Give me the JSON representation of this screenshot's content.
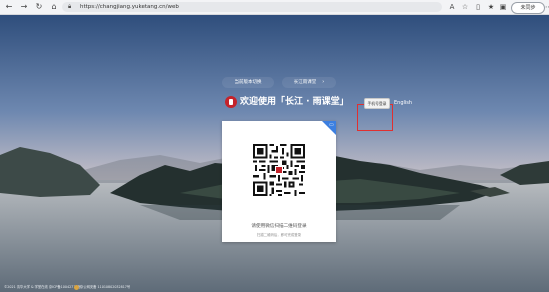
{
  "browser": {
    "url": "https://changjiang.yuketang.cn/web",
    "sync_label": "未同步"
  },
  "header": {
    "link_left": "当前版本切换",
    "link_right": "长江雨课堂",
    "welcome": "欢迎使用「长江 · 雨课堂」",
    "switch_label": "手机号登录",
    "english": "English"
  },
  "login": {
    "qr_hint": "请使用微信扫描二维码登录",
    "qr_sub": "扫描二维码后，即可完成登录"
  },
  "footer": {
    "left": "©2021 清华大学 & 学堂在线 京ICP备10042774号",
    "right": "京公网安备 11010802032817号"
  },
  "colors": {
    "accent": "#3c7fe0",
    "logo": "#c4232b",
    "highlight": "#e03030"
  }
}
